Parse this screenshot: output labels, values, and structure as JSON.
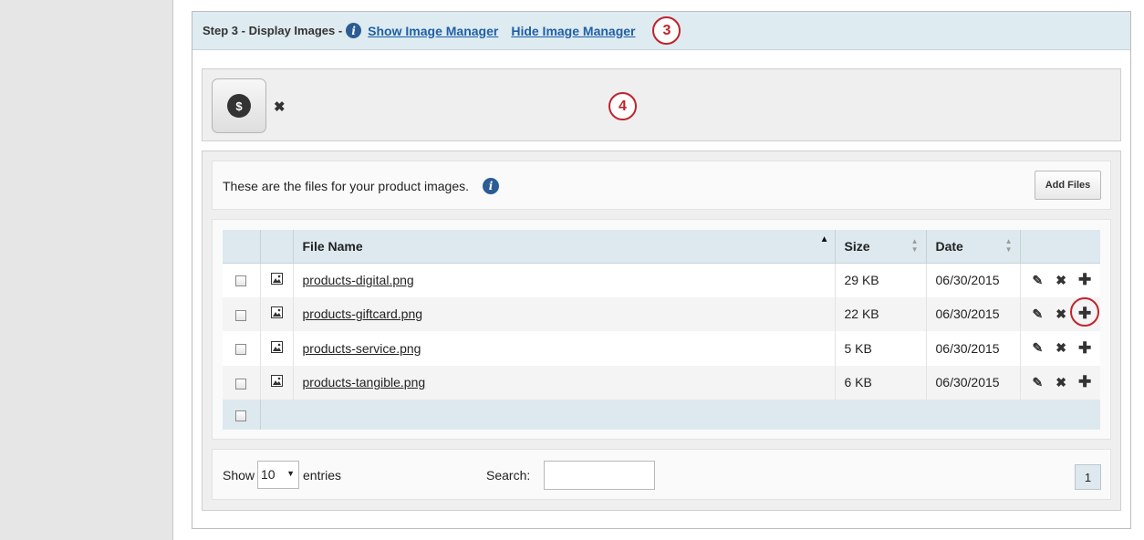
{
  "header": {
    "step_title": "Step 3 - Display Images -",
    "show_link": "Show Image Manager",
    "hide_link": "Hide Image Manager",
    "callout": "3"
  },
  "thumbnails": {
    "dollar_symbol": "$",
    "remove_symbol": "✖",
    "callout": "4"
  },
  "files": {
    "description": "These are the files for your product images.",
    "add_files_label": "Add Files",
    "columns": {
      "file_name": "File Name",
      "size": "Size",
      "date": "Date"
    },
    "rows": [
      {
        "name": "products-digital.png",
        "size": "29 KB",
        "date": "06/30/2015"
      },
      {
        "name": "products-giftcard.png",
        "size": "22 KB",
        "date": "06/30/2015"
      },
      {
        "name": "products-service.png",
        "size": "5 KB",
        "date": "06/30/2015"
      },
      {
        "name": "products-tangible.png",
        "size": "6 KB",
        "date": "06/30/2015"
      }
    ]
  },
  "pagination": {
    "show_label": "Show",
    "entries_value": "10",
    "entries_label": "entries",
    "search_label": "Search:",
    "search_value": "",
    "current_page": "1"
  },
  "colors": {
    "link": "#1f5fa8",
    "callout": "#c0232c",
    "header_bg": "#deebf0"
  }
}
